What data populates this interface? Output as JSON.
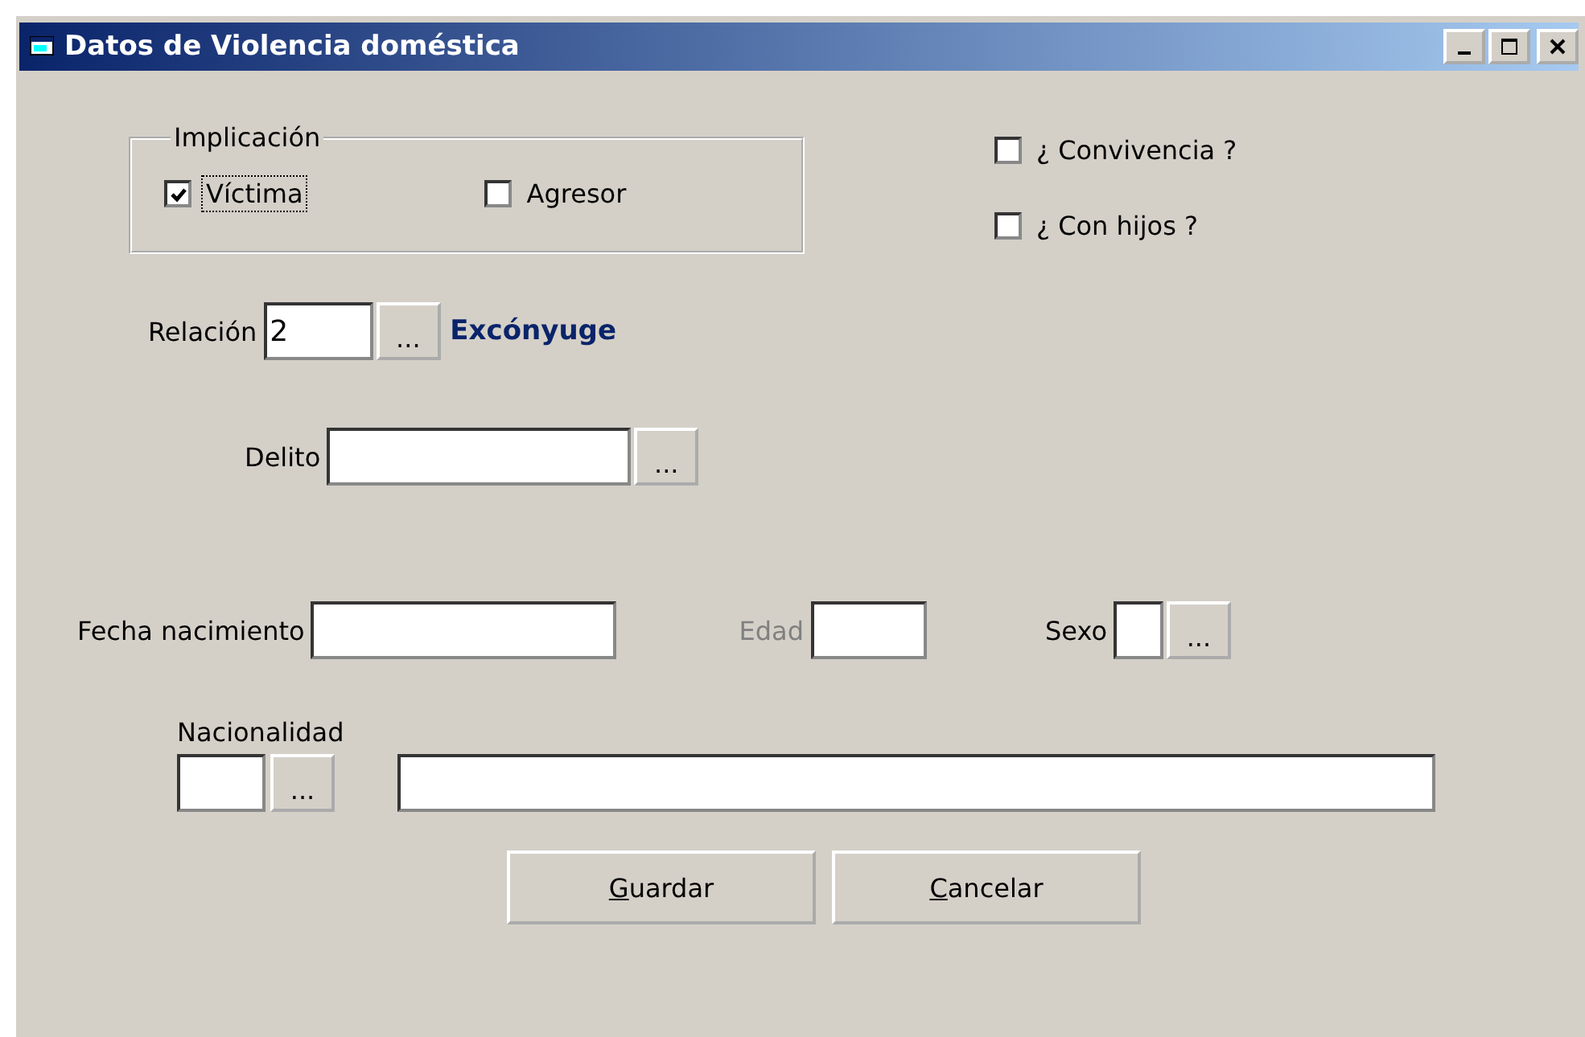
{
  "window": {
    "title": "Datos de Violencia doméstica"
  },
  "implicacion": {
    "legend": "Implicación",
    "options": [
      {
        "label": "Víctima",
        "checked": true,
        "focused": true
      },
      {
        "label": "Agresor",
        "checked": false,
        "focused": false
      }
    ]
  },
  "flags": [
    {
      "label": "¿ Convivencia ?",
      "checked": false
    },
    {
      "label": "¿ Con hijos ?",
      "checked": false
    }
  ],
  "relacion": {
    "label": "Relación",
    "value": "2",
    "button": "...",
    "description": "Excónyuge"
  },
  "delito": {
    "label": "Delito",
    "button": "..."
  },
  "fecha_nacimiento": {
    "label": "Fecha nacimiento"
  },
  "edad": {
    "label": "Edad",
    "disabled": true
  },
  "sexo": {
    "label": "Sexo",
    "button": "..."
  },
  "nacionalidad": {
    "label": "Nacionalidad",
    "button": "..."
  },
  "buttons": [
    {
      "label": "Guardar",
      "first_letter_underlined": true
    },
    {
      "label": "Cancelar",
      "first_letter_underlined": true
    }
  ]
}
